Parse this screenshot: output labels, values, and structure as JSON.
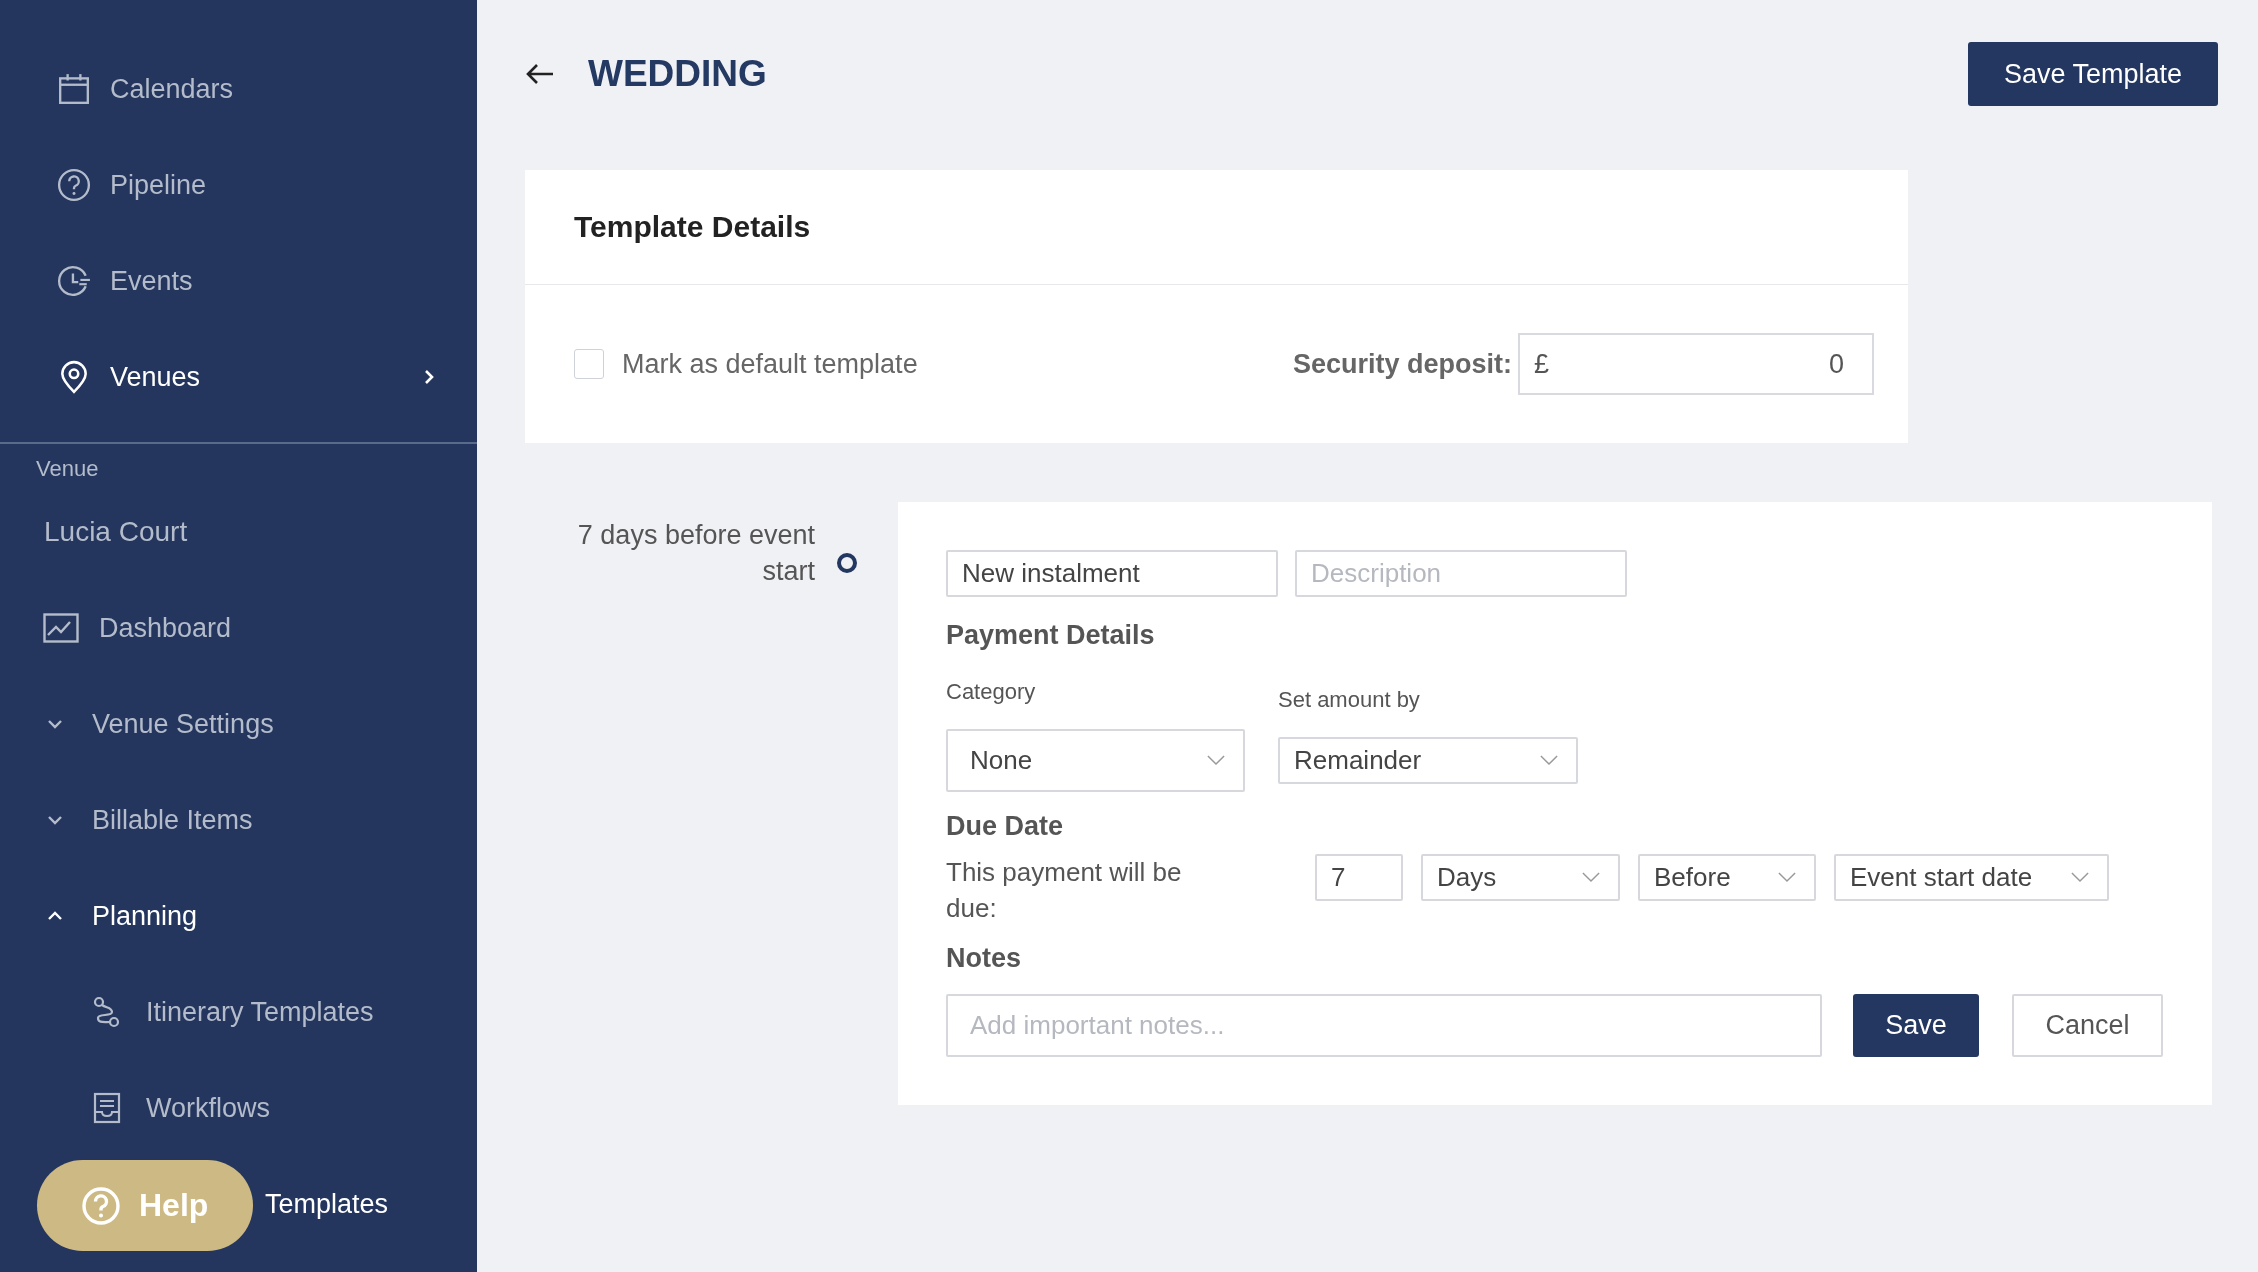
{
  "sidebar": {
    "nav": [
      {
        "label": "Calendars",
        "selected": false
      },
      {
        "label": "Pipeline",
        "selected": false
      },
      {
        "label": "Events",
        "selected": false
      },
      {
        "label": "Venues",
        "selected": true
      }
    ],
    "section_label": "Venue",
    "venue_name": "Lucia Court",
    "venue_menu": [
      {
        "kind": "link",
        "label": "Dashboard",
        "selected": false
      },
      {
        "kind": "group",
        "label": "Venue Settings",
        "expanded": false
      },
      {
        "kind": "group",
        "label": "Billable Items",
        "expanded": false
      },
      {
        "kind": "group",
        "label": "Planning",
        "expanded": true,
        "children": [
          {
            "label": "Itinerary Templates",
            "selected": false
          },
          {
            "label": "Workflows",
            "selected": false
          },
          {
            "label": "Templates",
            "selected": true
          }
        ]
      }
    ]
  },
  "help_button": {
    "label": "Help"
  },
  "header": {
    "title": "WEDDING",
    "save_button": "Save Template"
  },
  "template_details": {
    "title": "Template Details",
    "default_template": {
      "label": "Mark as default template",
      "checked": false
    },
    "security_deposit": {
      "label": "Security deposit:",
      "currency": "£",
      "value": "0"
    }
  },
  "instalment": {
    "timeline_label": "7 days before event start",
    "name": {
      "value": "New instalment"
    },
    "description": {
      "placeholder": "Description"
    },
    "payment_details": {
      "title": "Payment Details",
      "category": {
        "label": "Category",
        "value": "None"
      },
      "amount_by": {
        "label": "Set amount by",
        "value": "Remainder"
      }
    },
    "due_date": {
      "title": "Due Date",
      "label": "This payment will be due:",
      "count": "7",
      "unit": "Days",
      "relation": "Before",
      "anchor": "Event start date"
    },
    "notes": {
      "title": "Notes",
      "placeholder": "Add important notes..."
    },
    "buttons": {
      "save": "Save",
      "cancel": "Cancel"
    }
  }
}
